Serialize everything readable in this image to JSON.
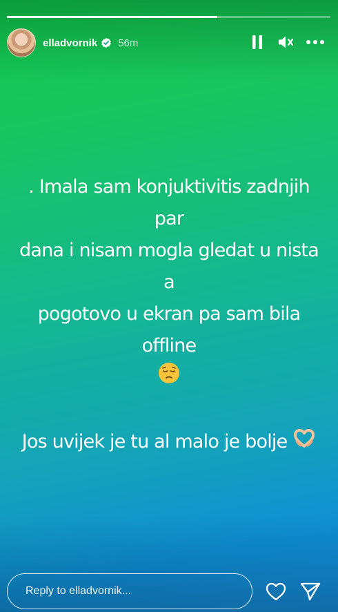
{
  "story": {
    "username": "elladvornik",
    "time_ago": "56m",
    "progress_fraction": 0.65,
    "text_lines": [
      ". Imala sam konjuktivitis zadnjih par",
      "dana i nisam mogla gledat u nista a",
      "pogotovo u ekran pa sam bila offline"
    ],
    "second_paragraph": "Jos uvijek je tu al malo je bolje",
    "emoji_1": "pensive-face-emoji",
    "emoji_2": "heart-hands-emoji"
  },
  "footer": {
    "reply_placeholder": "Reply to elladvornik..."
  },
  "icons": {
    "pause": "pause-icon",
    "mute": "volume-muted-icon",
    "more": "more-horizontal-icon",
    "like": "heart-icon",
    "share": "send-icon",
    "verified": "verified-badge-icon"
  }
}
